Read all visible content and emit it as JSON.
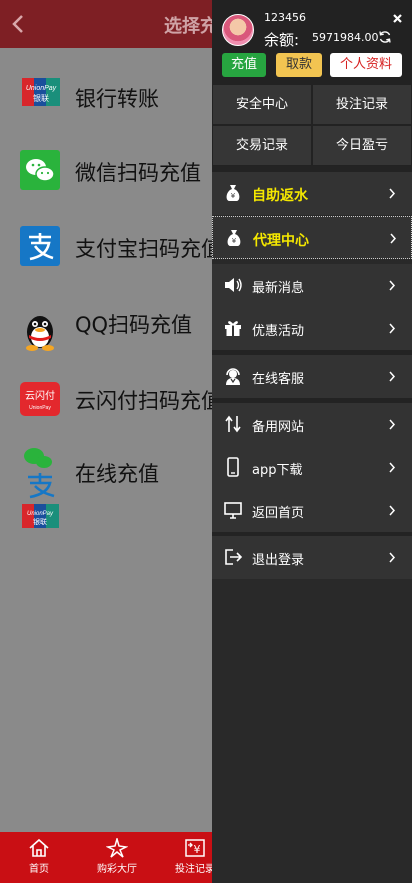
{
  "header": {
    "title": "选择充"
  },
  "payment_methods": [
    {
      "label": "银行转账",
      "icon": "unionpay-icon"
    },
    {
      "label": "微信扫码充值",
      "icon": "wechat-icon"
    },
    {
      "label": "支付宝扫码充值",
      "icon": "alipay-icon"
    },
    {
      "label": "QQ扫码充值",
      "icon": "qq-icon"
    },
    {
      "label": "云闪付扫码充值",
      "icon": "quickpass-icon"
    },
    {
      "label": "在线充值",
      "icon": "multi-pay-icon"
    }
  ],
  "unionpay_logo": {
    "line1": "UnionPay",
    "line2": "银联"
  },
  "quickpass_logo": {
    "line1": "云闪付",
    "line2": "UnionPay"
  },
  "tabbar": [
    {
      "label": "首页",
      "icon": "home-icon"
    },
    {
      "label": "购彩大厅",
      "icon": "lottery-hall-icon"
    },
    {
      "label": "投注记录",
      "icon": "bet-record-icon"
    }
  ],
  "drawer": {
    "username": "123456",
    "balance_label": "余额:",
    "balance_value": "5971984.00",
    "buttons": {
      "recharge": "充值",
      "withdraw": "取款",
      "profile": "个人资料"
    },
    "grid": [
      "安全中心",
      "投注记录",
      "交易记录",
      "今日盈亏"
    ],
    "menu": [
      {
        "label": "自助返水",
        "icon": "money-bag-icon",
        "highlight": true
      },
      {
        "label": "代理中心",
        "icon": "money-bag-icon",
        "highlight": true
      },
      {
        "label": "最新消息",
        "icon": "speaker-icon"
      },
      {
        "label": "优惠活动",
        "icon": "gift-icon"
      },
      {
        "label": "在线客服",
        "icon": "customer-service-icon"
      },
      {
        "label": "备用网站",
        "icon": "switch-icon"
      },
      {
        "label": "app下载",
        "icon": "phone-icon"
      },
      {
        "label": "返回首页",
        "icon": "monitor-icon"
      },
      {
        "label": "退出登录",
        "icon": "logout-icon"
      }
    ]
  },
  "colors": {
    "header": "#7e1f24",
    "tabbar": "#c90f14",
    "drawer": "#292929",
    "highlight_text": "#f5e800",
    "recharge_button": "#27a540",
    "withdraw_button": "#f2c451"
  }
}
